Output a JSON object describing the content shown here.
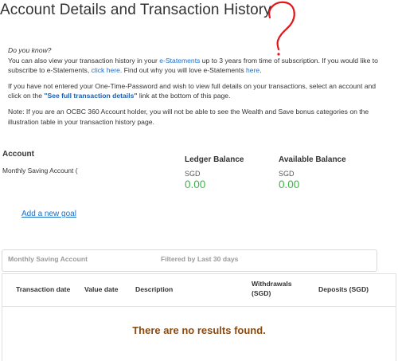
{
  "page": {
    "title": "Account Details and Transaction History"
  },
  "info": {
    "did_you_know": "Do you know?",
    "p1_part1": "You can also view your transaction history in your ",
    "p1_link_estatements": "e-Statements",
    "p1_part2": " up to 3 years from time of subscription. If you would like to subscribe to e-Statements, ",
    "p1_link_click_here": "click here",
    "p1_part3": ". Find out why you will love e-Statements ",
    "p1_link_here": "here",
    "p1_part4": ".",
    "p2_part1": "If you have not entered your One-Time-Password and wish to view full details on your transactions, select an account and click on the ",
    "p2_link": "\"See full transaction details\"",
    "p2_part2": " link at the bottom of this page.",
    "p3": "Note: If you are an OCBC 360 Account holder, you will not be able to see the Wealth and Save bonus categories on the illustration table in your transaction history page."
  },
  "account": {
    "heading": "Account",
    "name": "Monthly Saving Account (",
    "ledger_label": "Ledger Balance",
    "ledger_currency": "SGD",
    "ledger_amount": "0.00",
    "available_label": "Available Balance",
    "available_currency": "SGD",
    "available_amount": "0.00",
    "add_goal": "Add a new goal"
  },
  "filter": {
    "account": "Monthly Saving Account",
    "period": "Filtered by Last 30 days"
  },
  "table": {
    "columns": {
      "transaction_date": "Transaction date",
      "value_date": "Value date",
      "description": "Description",
      "withdrawals_line1": "Withdrawals",
      "withdrawals_line2": "(SGD)",
      "deposits": "Deposits (SGD)"
    },
    "empty_message": "There are no results found."
  },
  "colors": {
    "link": "#1a6fc9",
    "amount_green": "#3bb54a",
    "no_results_brown": "#8a4b12",
    "scribble_red": "#e0161b"
  }
}
